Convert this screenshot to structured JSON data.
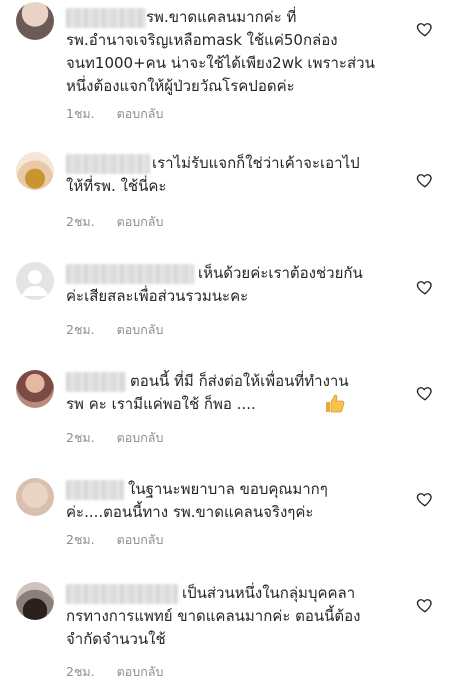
{
  "comments": [
    {
      "text": "รพ.ขาดแคลนมากค่ะ ที่\nรพ.อำนาจเจริญเหลือmask ใช้แค่50กล่อง\nจนท1000+คน น่าจะใช้ได้เพียง2wk เพราะส่วน\nหนึ่งต้องแจกให้ผู้ป่วยวัณโรคปอดค่ะ",
      "time": "1ชม.",
      "reply": "ตอบกลับ"
    },
    {
      "text": "เราไม่รับแจกก็ใช่ว่าเค้าจะเอาไป\nให้ที่รพ. ใช้นี่คะ",
      "time": "2ชม.",
      "reply": "ตอบกลับ"
    },
    {
      "text": "เห็นด้วยค่ะเราต้องช่วยกัน\nค่ะเสียสละเพื่อส่วนรวมนะคะ",
      "time": "2ชม.",
      "reply": "ตอบกลับ"
    },
    {
      "text": "ตอนนี้ ที่มี ก็ส่งต่อให้เพื่อนที่ทำงาน\nรพ คะ เรามีแค่พอใช้ ก็พอ ....",
      "time": "2ชม.",
      "reply": "ตอบกลับ",
      "emoji": "thumbs-up-emoji"
    },
    {
      "text": "ในฐานะพยาบาล ขอบคุณมากๆ\nค่ะ....ตอนนี้ทาง รพ.ขาดแคลนจริงๆค่ะ",
      "time": "2ชม.",
      "reply": "ตอบกลับ"
    },
    {
      "text": "เป็นส่วนหนึ่งในกลุ่มบุคคลา\nกรทางการแพทย์ ขาดแคลนมากค่ะ ตอนนี้ต้อง\nจำกัดจำนวนใช้",
      "time": "2ชม.",
      "reply": "ตอบกลับ"
    }
  ],
  "icons": {
    "like": "heart-icon",
    "avatar": "avatar"
  },
  "colors": {
    "text": "#262626",
    "meta": "#8e8e8e",
    "heart_stroke": "#262626"
  }
}
